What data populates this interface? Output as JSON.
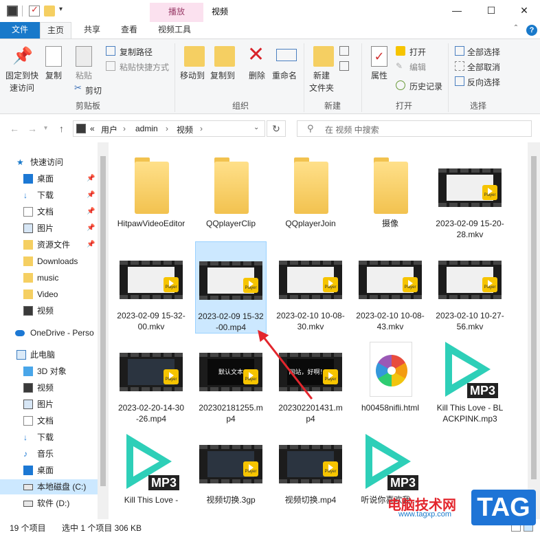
{
  "window": {
    "context_group": "播放",
    "title": "视频",
    "minimize": "—",
    "maximize": "☐",
    "close": "✕"
  },
  "tabs": [
    "文件",
    "主页",
    "共享",
    "查看",
    "视频工具"
  ],
  "ribbon": {
    "clipboard": {
      "pin_quick": "固定到快",
      "pin_quick2": "速访问",
      "copy": "复制",
      "paste": "粘贴",
      "copy_path": "复制路径",
      "paste_shortcut": "粘贴快捷方式",
      "cut": "剪切",
      "group": "剪贴板"
    },
    "organize": {
      "move_to": "移动到",
      "copy_to": "复制到",
      "delete": "删除",
      "rename": "重命名",
      "group": "组织"
    },
    "new": {
      "new_folder": "新建",
      "new_folder2": "文件夹",
      "group": "新建"
    },
    "open": {
      "properties": "属性",
      "open": "打开",
      "edit": "编辑",
      "history": "历史记录",
      "group": "打开"
    },
    "select": {
      "select_all": "全部选择",
      "select_none": "全部取消",
      "invert": "反向选择",
      "group": "选择"
    }
  },
  "address": {
    "crumbs": [
      "«",
      "用户",
      "›",
      "admin",
      "›",
      "视频",
      "›"
    ],
    "search_placeholder": "在 视频 中搜索"
  },
  "nav": {
    "quick_access": "快速访问",
    "items": [
      {
        "label": "桌面",
        "pinned": true
      },
      {
        "label": "下载",
        "pinned": true
      },
      {
        "label": "文档",
        "pinned": true
      },
      {
        "label": "图片",
        "pinned": true
      },
      {
        "label": "资源文件",
        "pinned": true
      },
      {
        "label": "Downloads",
        "pinned": false
      },
      {
        "label": "music",
        "pinned": false
      },
      {
        "label": "Video",
        "pinned": false
      },
      {
        "label": "视频",
        "pinned": false
      }
    ],
    "onedrive": "OneDrive - Perso",
    "this_pc": "此电脑",
    "pc_items": [
      "3D 对象",
      "视频",
      "图片",
      "文档",
      "下载",
      "音乐",
      "桌面",
      "本地磁盘 (C:)",
      "软件 (D:)"
    ]
  },
  "files": [
    {
      "name": "HitpawVideoEditor",
      "type": "folder"
    },
    {
      "name": "QQplayerClip",
      "type": "folder"
    },
    {
      "name": "QQplayerJoin",
      "type": "folder"
    },
    {
      "name": "摄像",
      "type": "folder"
    },
    {
      "name": "2023-02-09 15-20-28.mkv",
      "type": "video"
    },
    {
      "name": "2023-02-09 15-32-00.mkv",
      "type": "video"
    },
    {
      "name": "2023-02-09 15-32-00.mp4",
      "type": "video",
      "selected": true
    },
    {
      "name": "2023-02-10 10-08-30.mkv",
      "type": "video"
    },
    {
      "name": "2023-02-10 10-08-43.mkv",
      "type": "video"
    },
    {
      "name": "2023-02-10 10-27-56.mkv",
      "type": "video"
    },
    {
      "name": "2023-02-20-14-30-26.mp4",
      "type": "video"
    },
    {
      "name": "202302181255.mp4",
      "type": "video",
      "screen_text": "默认文本"
    },
    {
      "name": "202302201431.mp4",
      "type": "video",
      "screen_text": "网站，好啊！！"
    },
    {
      "name": "h00458nifli.html",
      "type": "html"
    },
    {
      "name": "Kill This Love - BLACKPINK.mp3",
      "type": "mp3"
    },
    {
      "name": "Kill This Love -",
      "type": "mp3"
    },
    {
      "name": "视频切换.3gp",
      "type": "video"
    },
    {
      "name": "视频切换.mp4",
      "type": "video"
    },
    {
      "name": "听说你喜欢我 ...",
      "type": "mp3"
    }
  ],
  "player_badge": "Player",
  "mp3_label": "MP3",
  "status": {
    "count": "19 个项目",
    "selected": "选中 1 个项目  306 KB"
  },
  "watermark": {
    "site": "电脑技术网",
    "url": "www.tagxp.com",
    "tag": "TAG"
  },
  "colors": {
    "file_tab": "#1979ca",
    "selection": "#cce8ff",
    "context_group": "#fbe1ef",
    "arrow": "#e3262d"
  }
}
